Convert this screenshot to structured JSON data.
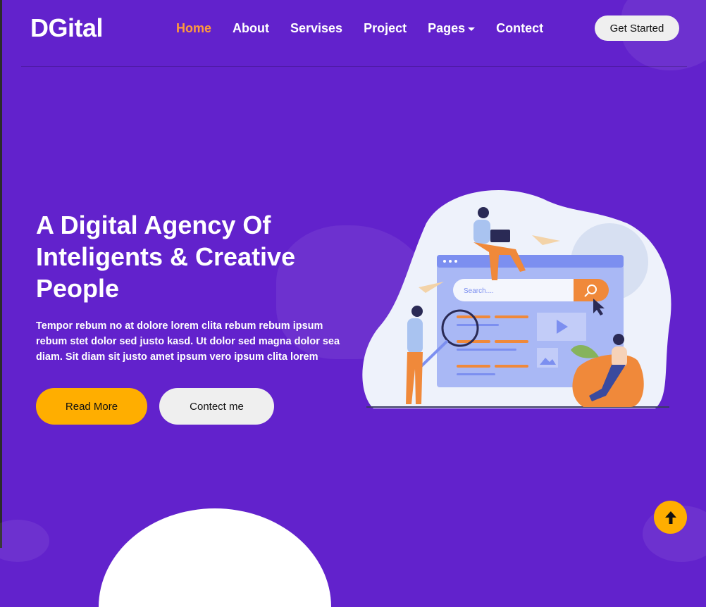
{
  "brand": {
    "logo_text": "DGital"
  },
  "nav": {
    "items": [
      {
        "label": "Home",
        "active": true
      },
      {
        "label": "About"
      },
      {
        "label": "Servises"
      },
      {
        "label": "Project"
      },
      {
        "label": "Pages",
        "has_dropdown": true
      },
      {
        "label": "Contect"
      }
    ],
    "cta_label": "Get Started"
  },
  "hero": {
    "title": "A Digital Agency Of Inteligents & Creative People",
    "text": "Tempor rebum no at dolore lorem clita rebum rebum ipsum rebum stet dolor sed justo kasd. Ut dolor sed magna dolor sea diam. Sit diam sit justo amet ipsum vero ipsum clita lorem",
    "primary_button": "Read More",
    "secondary_button": "Contect me"
  },
  "illustration": {
    "search_placeholder": "Search...."
  },
  "colors": {
    "background": "#6222cc",
    "accent": "#ffae00",
    "active_link": "#ff9a3c"
  },
  "icons": {
    "back_to_top": "arrow-up-icon",
    "dropdown": "caret-down-icon"
  }
}
